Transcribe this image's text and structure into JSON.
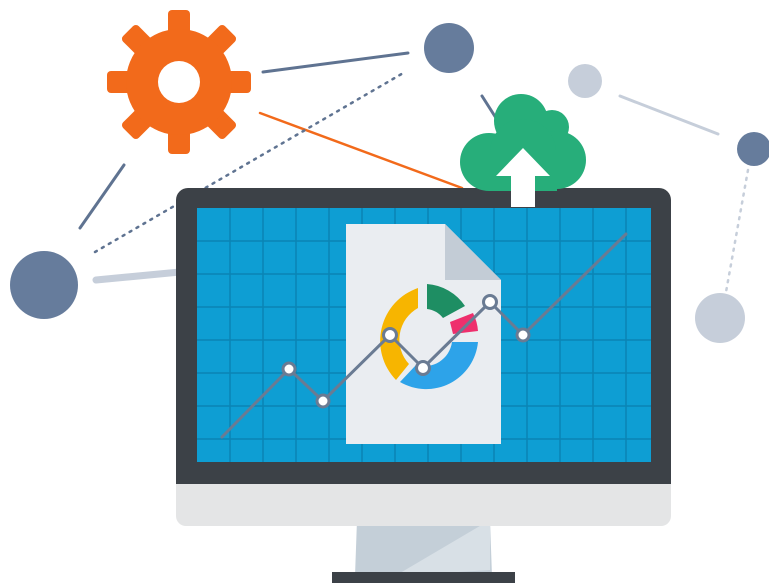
{
  "colors": {
    "background": "#ffffff",
    "gear": "#f26a1b",
    "cloud": "#27ae7a",
    "node_dark": "#667c9c",
    "node_light": "#c6ceda",
    "line_dark": "#5f7391",
    "line_light": "#c6ceda",
    "accent_line": "#f26a1b",
    "monitor_bezel": "#3c4147",
    "monitor_chin": "#e4e5e6",
    "screen": "#0e9ed3",
    "screen_grid": "#0a84b4",
    "stand": "#c4cfd8",
    "document": "#eaedf1",
    "document_fold": "#c3ccd6",
    "trend_line": "#6a7b93",
    "donut": [
      "#f7b500",
      "#1e8e63",
      "#ee2f6d",
      "#2da3e9"
    ]
  },
  "icons": [
    "gear-icon",
    "cloud-upload-icon",
    "document-icon",
    "donut-chart-icon",
    "monitor-icon"
  ]
}
